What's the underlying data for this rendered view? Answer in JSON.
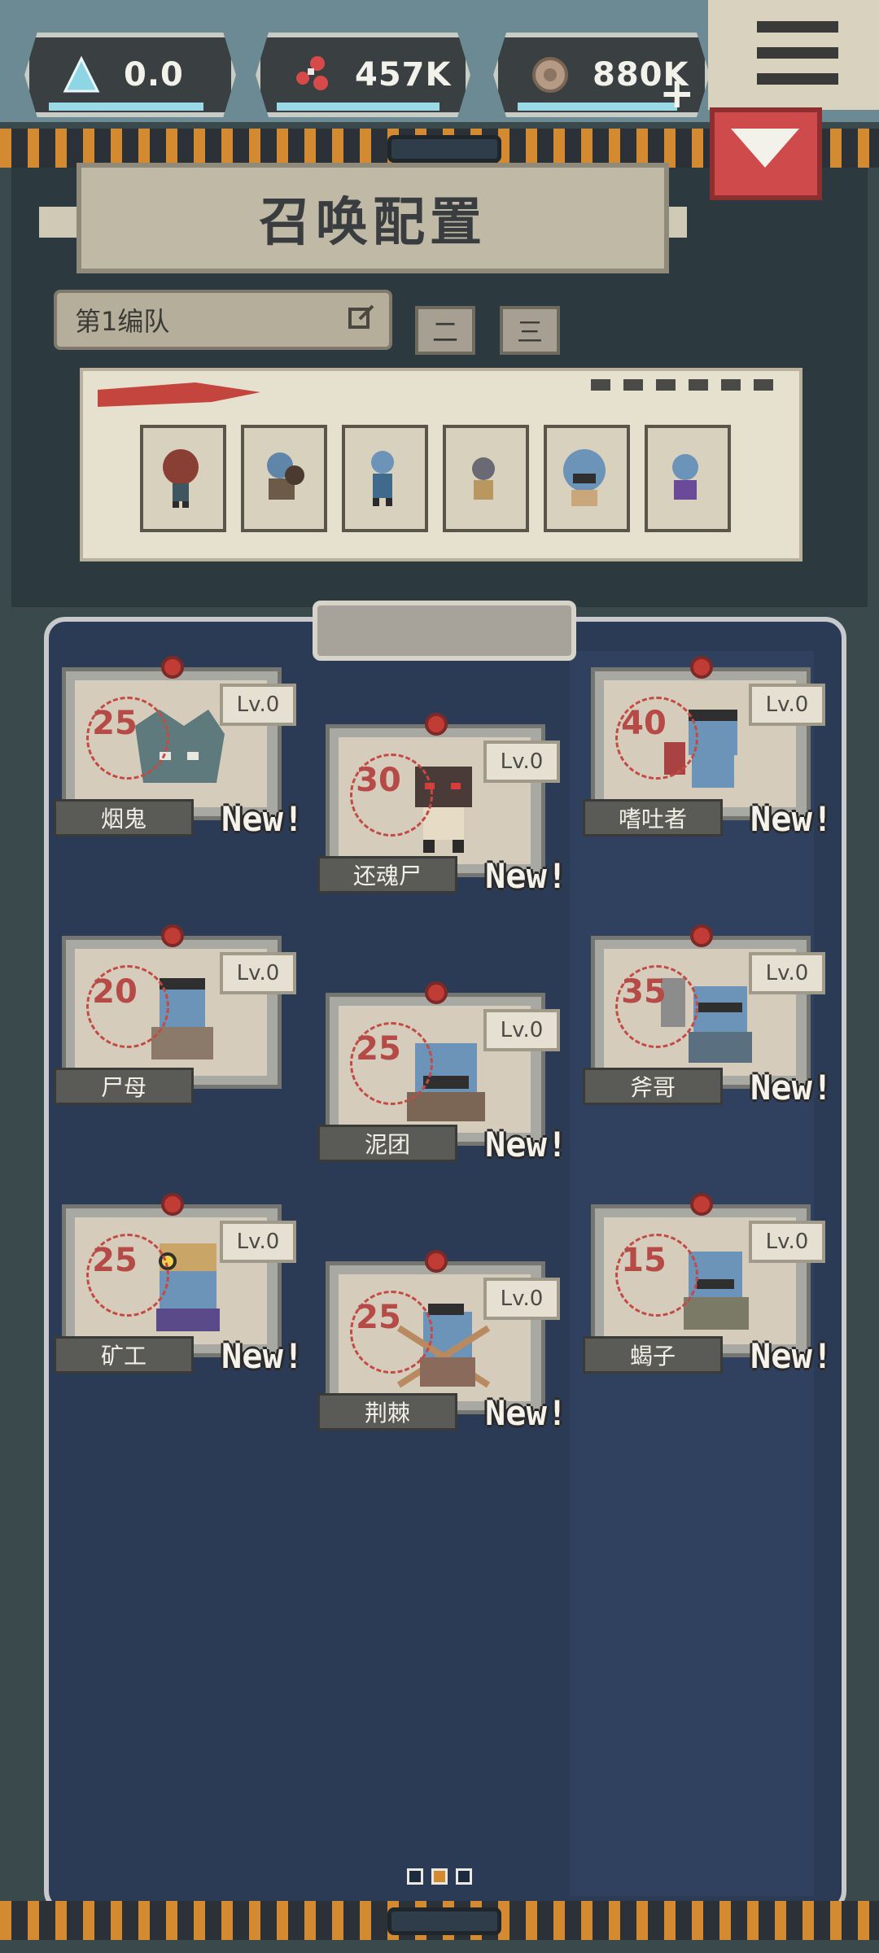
{
  "resources": [
    {
      "icon": "crystal-icon",
      "value": "0.0"
    },
    {
      "icon": "blood-cells-icon",
      "value": "457K"
    },
    {
      "icon": "stone-coin-icon",
      "value": "880K"
    }
  ],
  "add_label": "+",
  "title": "召唤配置",
  "squad": {
    "selected": "第1编队",
    "tabs": [
      "二",
      "三"
    ]
  },
  "colors": {
    "accent_red": "#c23c36",
    "panel_navy": "#2b3a55",
    "hazard_orange": "#d48a30"
  },
  "monsters": [
    {
      "name": "烟鬼",
      "cost": "25",
      "level": "Lv.0",
      "new": "New!"
    },
    {
      "name": "还魂尸",
      "cost": "30",
      "level": "Lv.0",
      "new": "New!"
    },
    {
      "name": "嗜吐者",
      "cost": "40",
      "level": "Lv.0",
      "new": "New!"
    },
    {
      "name": "尸母",
      "cost": "20",
      "level": "Lv.0",
      "new": ""
    },
    {
      "name": "泥团",
      "cost": "25",
      "level": "Lv.0",
      "new": "New!"
    },
    {
      "name": "斧哥",
      "cost": "35",
      "level": "Lv.0",
      "new": "New!"
    },
    {
      "name": "矿工",
      "cost": "25",
      "level": "Lv.0",
      "new": "New!"
    },
    {
      "name": "荆棘",
      "cost": "25",
      "level": "Lv.0",
      "new": "New!"
    },
    {
      "name": "蝎子",
      "cost": "15",
      "level": "Lv.0",
      "new": "New!"
    }
  ],
  "pager": {
    "count": 3,
    "active": 1
  }
}
